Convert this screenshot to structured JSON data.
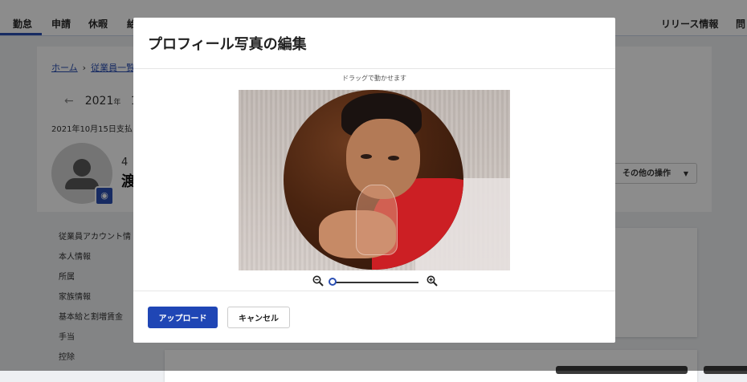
{
  "topnav": {
    "items": [
      "勤怠",
      "申請",
      "休暇",
      "給"
    ],
    "right_items": [
      "リリース情報",
      "問"
    ],
    "active_index": 0
  },
  "breadcrumb": {
    "home": "ホーム",
    "employee_list": "従業員一覧"
  },
  "period": {
    "year": "2021",
    "year_suffix": "年",
    "month_fragment": "1",
    "pay_date": "2021年10月15日支払い"
  },
  "employee": {
    "number_fragment": "4",
    "name_fragment": "渡"
  },
  "actions": {
    "other_ops": "その他の操作"
  },
  "sidebar": {
    "items": [
      "従業員アカウント情",
      "本人情報",
      "所属",
      "家族情報",
      "基本給と割増賃金",
      "手当",
      "控除"
    ]
  },
  "modal": {
    "title": "プロフィール写真の編集",
    "drag_hint": "ドラッグで動かせます",
    "zoom_level": 0,
    "upload_label": "アップロード",
    "cancel_label": "キャンセル"
  },
  "colors": {
    "accent": "#1f46b5",
    "nav_active": "#2b4fb3"
  },
  "icons": {
    "zoom_out": "zoom-out-icon",
    "zoom_in": "zoom-in-icon",
    "camera": "camera-icon",
    "avatar": "person-icon"
  }
}
